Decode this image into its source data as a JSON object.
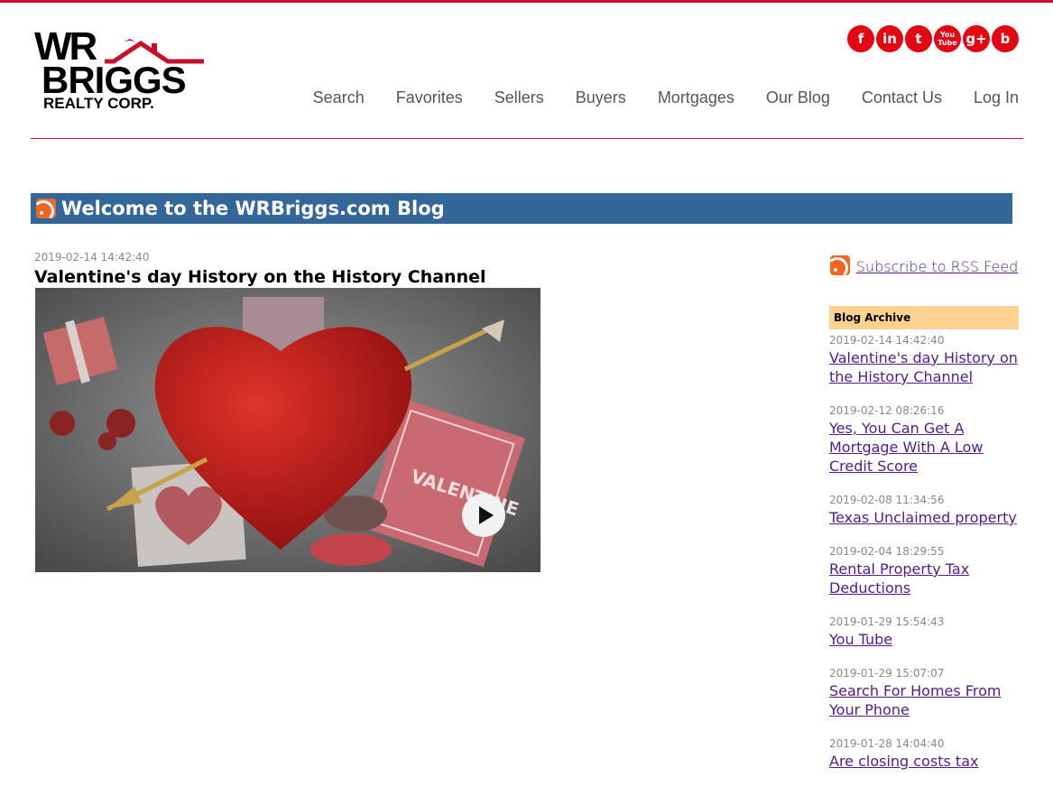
{
  "logo": {
    "line1": "WR",
    "line2": "BRIGGS",
    "line3": "REALTY CORP."
  },
  "social": [
    {
      "icon": "facebook-icon",
      "glyph": "f"
    },
    {
      "icon": "linkedin-icon",
      "glyph": "in"
    },
    {
      "icon": "twitter-icon",
      "glyph": "t"
    },
    {
      "icon": "youtube-icon",
      "glyph": "You Tube"
    },
    {
      "icon": "google-plus-icon",
      "glyph": "g+"
    },
    {
      "icon": "blog-icon",
      "glyph": "b"
    }
  ],
  "nav": {
    "search": "Search",
    "favorites": "Favorites",
    "sellers": "Sellers",
    "buyers": "Buyers",
    "mortgages": "Mortgages",
    "blog": "Our Blog",
    "contact": "Contact Us",
    "login": "Log In"
  },
  "blog_header": {
    "title": "Welcome to the WRBriggs.com Blog"
  },
  "post": {
    "date": "2019-02-14 14:42:40",
    "title": "Valentine's day History on the History Channel"
  },
  "sidebar": {
    "subscribe_label": "Subscribe to RSS Feed",
    "archive_title": "Blog Archive",
    "archive": [
      {
        "date": "2019-02-14 14:42:40",
        "title": "Valentine's day History on the History Channel"
      },
      {
        "date": "2019-02-12 08:26:16",
        "title": "Yes, You Can Get A Mortgage With A Low Credit Score"
      },
      {
        "date": "2019-02-08 11:34:56",
        "title": "Texas Unclaimed property"
      },
      {
        "date": "2019-02-04 18:29:55",
        "title": "Rental Property Tax Deductions"
      },
      {
        "date": "2019-01-29 15:54:43",
        "title": "You Tube"
      },
      {
        "date": "2019-01-29 15:07:07",
        "title": "Search For Homes From Your Phone"
      },
      {
        "date": "2019-01-28 14:04:40",
        "title": "Are closing costs tax"
      }
    ]
  },
  "colors": {
    "brand_red": "#c8102e",
    "bar_blue": "#336699",
    "archive_header": "#ffd28f",
    "link_visited": "#551a8b"
  }
}
